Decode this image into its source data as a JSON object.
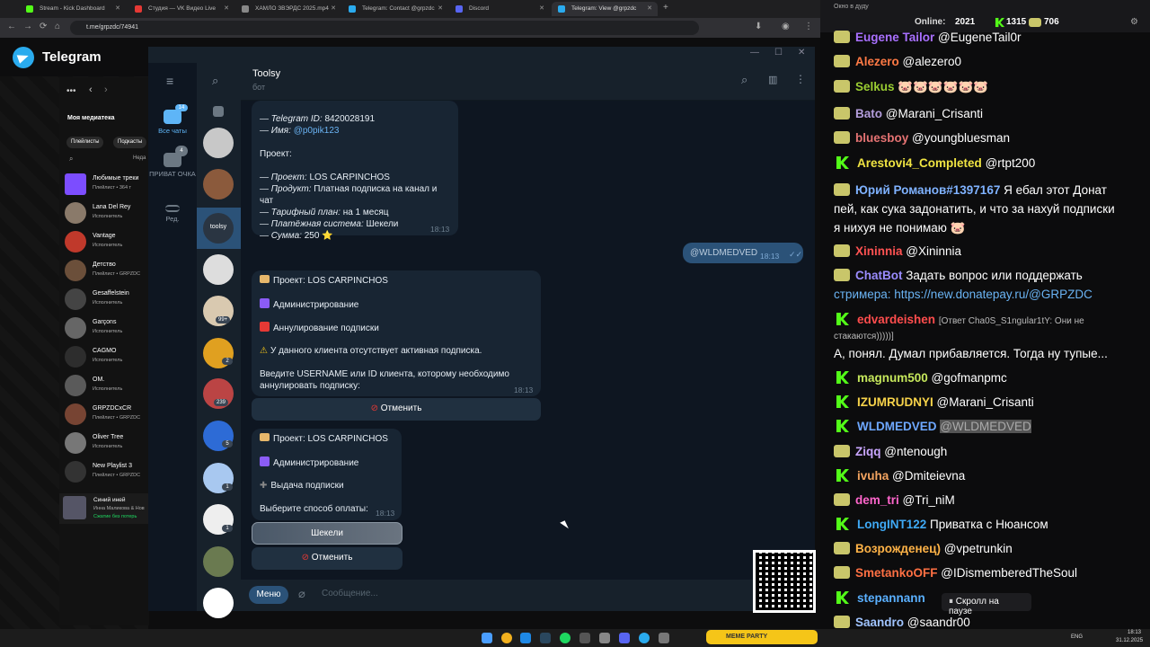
{
  "browser": {
    "tabs": [
      {
        "title": "Stream - Kick Dashboard",
        "color": "#53fc18"
      },
      {
        "title": "Студия — VK Видео Live",
        "color": "#e53935"
      },
      {
        "title": "ХАМЛО ЗВЭРДС 2025.mp4",
        "color": "#888888"
      },
      {
        "title": "Telegram: Contact @grpzdc",
        "color": "#2aabee"
      },
      {
        "title": "Discord",
        "color": "#5865f2"
      },
      {
        "title": "Telegram: View @grpzdc",
        "color": "#2aabee"
      }
    ],
    "url": "t.me/grpzdc/74941"
  },
  "tg_page": {
    "title": "Telegram"
  },
  "music": {
    "header": "Моя медиатека",
    "chips": [
      "Плейлисты",
      "Подкасты"
    ],
    "sort": "Неда",
    "items": [
      {
        "title": "Любимые треки",
        "sub": "Плейлист • 364 т",
        "color": "#7c4dff"
      },
      {
        "title": "Lana Del Rey",
        "sub": "Исполнитель",
        "color": "#8a7a6a"
      },
      {
        "title": "Vantage",
        "sub": "Исполнитель",
        "color": "#c0392b"
      },
      {
        "title": "Детство",
        "sub": "Плейлист • GRPZDC",
        "color": "#6b4f3a"
      },
      {
        "title": "Gesaffelstein",
        "sub": "Исполнитель",
        "color": "#444"
      },
      {
        "title": "Garçons",
        "sub": "Исполнитель",
        "color": "#666"
      },
      {
        "title": "CAGMO",
        "sub": "Исполнитель",
        "color": "#2d2d2d"
      },
      {
        "title": "OM.",
        "sub": "Исполнитель",
        "color": "#5a5a5a"
      },
      {
        "title": "GRPZDCxCR",
        "sub": "Плейлист • GRPZDC",
        "color": "#774433"
      },
      {
        "title": "Oliver Tree",
        "sub": "Исполнитель",
        "color": "#777"
      },
      {
        "title": "New Playlist 3",
        "sub": "Плейлист • GRPZDC",
        "color": "#333"
      }
    ],
    "now_playing": {
      "title": "Синий иней",
      "artist": "Инна Маликова & Нов",
      "status": "Сжатие без потерь"
    }
  },
  "tg": {
    "folders": [
      {
        "label": "Все чаты",
        "badge": "14"
      },
      {
        "label": "ПРИВАТ ОЧКА",
        "badge": "4"
      },
      {
        "label": "Ред.",
        "badge": ""
      }
    ],
    "chat_badges": [
      "99+",
      "2",
      "239",
      "5",
      "1",
      "1"
    ],
    "selected_avatar": "toolsy",
    "chat_name": "Toolsy",
    "chat_sub": "бот",
    "msg1": {
      "id_label": "— Telegram ID:",
      "id_value": "8420028191",
      "name_label": "— Имя:",
      "name_value": "@p0pik123",
      "project_heading": "Проект:",
      "project_label": "— Проект:",
      "project_value": "LOS CARPINCHOS",
      "product_label": "— Продукт:",
      "product_value": "Платная подписка на канал и чат",
      "plan_label": "— Тарифный план:",
      "plan_value": "на 1 месяц",
      "pay_label": "— Платёжная система:",
      "pay_value": "Шекели",
      "sum_label": "— Сумма:",
      "sum_value": "250 ⭐",
      "time": "18:13"
    },
    "msg_out": {
      "text": "@WLDMEDVED",
      "time": "18:13"
    },
    "msg2": {
      "project": "Проект: LOS CARPINCHOS",
      "admin": "Администрирование",
      "cancel_sub": "Аннулирование подписки",
      "warning": "У данного клиента отсутствует активная подписка.",
      "prompt": "Введите USERNAME или ID клиента, которому необходимо аннулировать подписку:",
      "time": "18:13",
      "button": "Отменить"
    },
    "msg3": {
      "project": "Проект: LOS CARPINCHOS",
      "admin": "Администрирование",
      "issue": "Выдача подписки",
      "prompt": "Выберите способ оплаты:",
      "time": "18:13",
      "button1": "Шекели",
      "button2": "Отменить"
    },
    "menu_button": "Меню",
    "input_placeholder": "Сообщение..."
  },
  "stream_chat": {
    "header_label": "Окно в дуду",
    "online_label": "Online:",
    "online_value": "2021",
    "kick_count": "1315",
    "vk_count": "706",
    "pause_label": "Скролл на паузе",
    "lines": [
      {
        "platform": "vk",
        "user": "Eugene Tailor",
        "color": "#a970ff",
        "text": "@EugeneTail0r"
      },
      {
        "platform": "vk",
        "user": "Alezero",
        "color": "#ff7a45",
        "text": "@alezero0"
      },
      {
        "platform": "vk",
        "user": "Selkus",
        "color": "#9acd32",
        "text": "🐷🐷🐷🐷🐷🐷"
      },
      {
        "platform": "vk",
        "user": "Bato",
        "color": "#b39ddb",
        "text": "@Marani_Crisanti"
      },
      {
        "platform": "vk",
        "user": "bluesboy",
        "color": "#e57373",
        "text": "@youngbluesman"
      },
      {
        "platform": "kick",
        "user": "Arestovi4_Completed",
        "color": "#f0e442",
        "text": "@rtpt200"
      },
      {
        "platform": "vk",
        "user": "Юрий Романов#1397167",
        "color": "#7fb2ff",
        "text": "Я ебал этот Донат"
      },
      {
        "platform": "none",
        "user": "",
        "color": "#fff",
        "text": "пей, как сука задонатить, и что за нахуй подписки"
      },
      {
        "platform": "none",
        "user": "",
        "color": "#fff",
        "text": "я нихуя не понимаю 🐷"
      },
      {
        "platform": "vk",
        "user": "Xininnia",
        "color": "#ff5252",
        "text": "@Xininnia"
      },
      {
        "platform": "vk",
        "user": "ChatBot",
        "color": "#9b8cff",
        "text": "Задать вопрос или поддержать"
      },
      {
        "platform": "none",
        "user": "",
        "color": "#fff",
        "text": "стримера: https://new.donatepay.ru/@GRPZDC"
      },
      {
        "platform": "kick",
        "user": "edvardeishen",
        "color": "#ff4d4d",
        "text": "[Ответ Cha0S_S1ngular1tY: Они не"
      },
      {
        "platform": "none",
        "user": "",
        "color": "#bbb",
        "text": "стакаются)))))]"
      },
      {
        "platform": "none",
        "user": "",
        "color": "#fff",
        "text": "А, понял. Думал прибавляется. Тогда ну тупые..."
      },
      {
        "platform": "kick",
        "user": "magnum500",
        "color": "#c6e85c",
        "text": "@gofmanpmc"
      },
      {
        "platform": "kick",
        "user": "IZUMRUDNYI",
        "color": "#f7d34a",
        "text": "@Marani_Crisanti"
      },
      {
        "platform": "kick",
        "user": "WLDMEDVED",
        "color": "#6ea8ff",
        "text": "@WLDMEDVED"
      },
      {
        "platform": "vk",
        "user": "Ziqq",
        "color": "#c9a6ff",
        "text": "@ntenough"
      },
      {
        "platform": "kick",
        "user": "ivuha",
        "color": "#f4a460",
        "text": "@Dmiteievna"
      },
      {
        "platform": "vk",
        "user": "dem_tri",
        "color": "#ff66cc",
        "text": "@Tri_niM"
      },
      {
        "platform": "kick",
        "user": "LongINT122",
        "color": "#3fa9f5",
        "text": "Приватка с Нюансом"
      },
      {
        "platform": "vk",
        "user": "Возрожденец)",
        "color": "#ffb347",
        "text": "@vpetrunkin"
      },
      {
        "platform": "vk",
        "user": "SmetankoOFF",
        "color": "#ff7043",
        "text": "@IDismemberedTheSoul"
      },
      {
        "platform": "kick",
        "user": "stepannann",
        "color": "#5ab0ff",
        "text": ""
      },
      {
        "platform": "vk",
        "user": "Saandro",
        "color": "#a0c4ff",
        "text": "@saandr00"
      }
    ]
  },
  "taskbar": {
    "lang": "ENG",
    "time": "18:13",
    "date": "31.12.2025",
    "overlay": "MEME PARTY"
  }
}
